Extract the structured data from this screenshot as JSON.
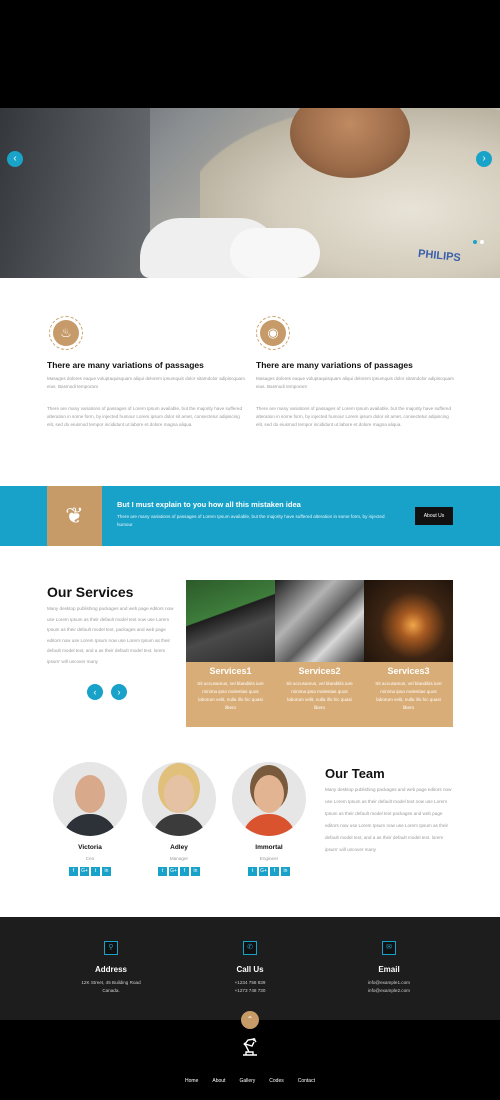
{
  "hero": {
    "prev_icon": "chevron-left-icon",
    "next_icon": "chevron-right-icon",
    "prev_glyph": "‹",
    "next_glyph": "›",
    "brand_mark": "PHILIPS",
    "slide_dots": 2,
    "active_slide": 1
  },
  "features": [
    {
      "icon": "flame-icon",
      "glyph": "♨",
      "title": "There are many variations of passages",
      "para1": "Masages dolores eaque voluptaquisquam aliqui delorem ipsumquis dolor sitamdolor adipiscquam eius. Basmodi temporant",
      "para2": "There are many variations of passages of Lorem Ipsum available, but the majority have suffered alteration in some form, by injected humour Lorem ipsum dolor sit amet, consectetur adipiscing elit, sed do eiusmod tempor incididunt ut labore et dolore magna aliqua."
    },
    {
      "icon": "piggy-bank-icon",
      "glyph": "◉",
      "title": "There are many variations of passages",
      "para1": "Masages dolores eaque voluptaquisquam aliqui delorem ipsumquis dolor sitamdolor adipiscquam eius. Basmodi temporant",
      "para2": "There are many variations of passages of Lorem Ipsum available, but the majority have suffered alteration in some form, by injected humour Lorem ipsum dolor sit amet, consectetur adipiscing elit, sed do eiusmod tempor incididunt ut labore et dolore magna aliqua."
    }
  ],
  "banner": {
    "icon": "leaf-icon",
    "glyph": "❦",
    "title": "But I must explain to you how all this mistaken idea",
    "text": "There are many variations of passages of Lorem Ipsum available, but the majority have suffered alteration in some form, by injected humour",
    "button": "About Us"
  },
  "services": {
    "title": "Our Services",
    "description": "Many desktop publishing packages and web page editors now use Lorem Ipsum as their default model text now use Lorem Ipsum as their default model text, packages and web page editors now use Lorem Ipsum now use Lorem Ipsum as their default model text, and a as their default model text. lorem ipsum' will uncover many",
    "prev_glyph": "‹",
    "next_glyph": "›",
    "cards": [
      {
        "title": "Services1",
        "text": "Sit accusamus, vel blanditiis iure minima ipsa molestias quos laborum velit, nulla illo hic quasi libero"
      },
      {
        "title": "Services2",
        "text": "Sit accusamus, vel blanditiis iure minima ipsa molestias quos laborum velit, nulla illo hic quasi libero"
      },
      {
        "title": "Services3",
        "text": "Sit accusamus, vel blanditiis iure minima ipsa molestias quos laborum velit, nulla illo hic quasi libero"
      }
    ]
  },
  "team": {
    "title": "Our Team",
    "description": "Many desktop publishing packages and web page editors now use Lorem Ipsum as their default model text now use Lorem Ipsum as their default model text packages and web page editors now use Lorem Ipsum now use Lorem Ipsum as their default model text, and a as their default model text. lorem ipsum' will uncover many",
    "members": [
      {
        "name": "Victoria",
        "role": "Ceo",
        "socials": [
          "f",
          "G+",
          "t",
          "in"
        ]
      },
      {
        "name": "Adley",
        "role": "Manager",
        "socials": [
          "t",
          "G+",
          "f",
          "in"
        ]
      },
      {
        "name": "Immortal",
        "role": "Engineer",
        "socials": [
          "t",
          "G+",
          "f",
          "in"
        ]
      }
    ]
  },
  "contact": [
    {
      "icon": "map-marker-icon",
      "glyph": "⚲",
      "title": "Address",
      "line1": "12K Street, 45 Building Road",
      "line2": "Canada."
    },
    {
      "icon": "phone-icon",
      "glyph": "✆",
      "title": "Call Us",
      "line1": "+1234 758 839",
      "line2": "+1273 748 730"
    },
    {
      "icon": "envelope-icon",
      "glyph": "✉",
      "title": "Email",
      "line1": "info@example1.com",
      "line2": "info@example2.com"
    }
  ],
  "footer": {
    "up_glyph": "⌃",
    "nav": [
      "Home",
      "About",
      "Gallery",
      "Codes",
      "Contact"
    ]
  },
  "colors": {
    "accent_blue": "#19a2c9",
    "accent_tan": "#c79b68",
    "dark": "#1d1d1d"
  }
}
